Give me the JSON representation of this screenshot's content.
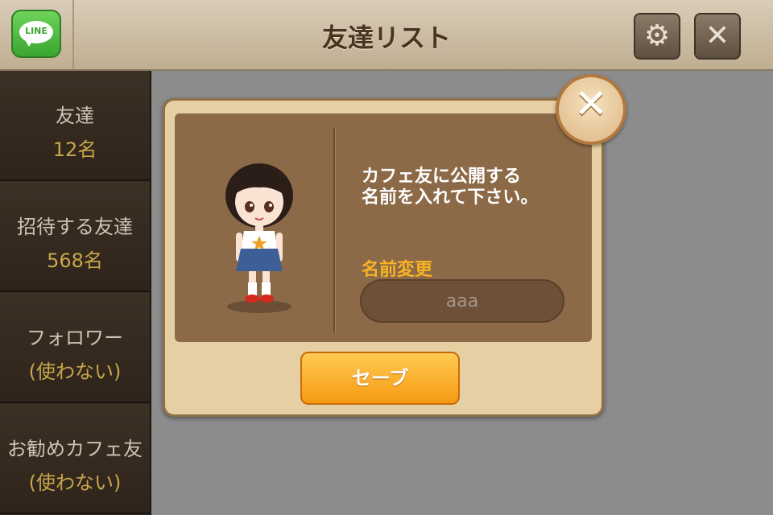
{
  "header": {
    "logo_text": "LINE",
    "title": "友達リスト"
  },
  "header_icons": {
    "settings": "gear-icon",
    "close": "close-icon"
  },
  "sidebar": {
    "items": [
      {
        "label": "友達",
        "value": "12名"
      },
      {
        "label": "招待する友達",
        "value": "568名"
      },
      {
        "label": "フォロワー",
        "value": "(使わない)"
      },
      {
        "label": "お勧めカフェ友",
        "value": "(使わない)"
      }
    ]
  },
  "dialog": {
    "prompt_lines": [
      "カフェ友に公開する",
      "名前を入れて下さい。"
    ],
    "name_label": "名前変更",
    "name_value": "aaa",
    "save_label": "セーブ"
  },
  "colors": {
    "accent_orange": "#f59a12",
    "label_gold": "#f7b324",
    "line_green": "#3aa531"
  }
}
